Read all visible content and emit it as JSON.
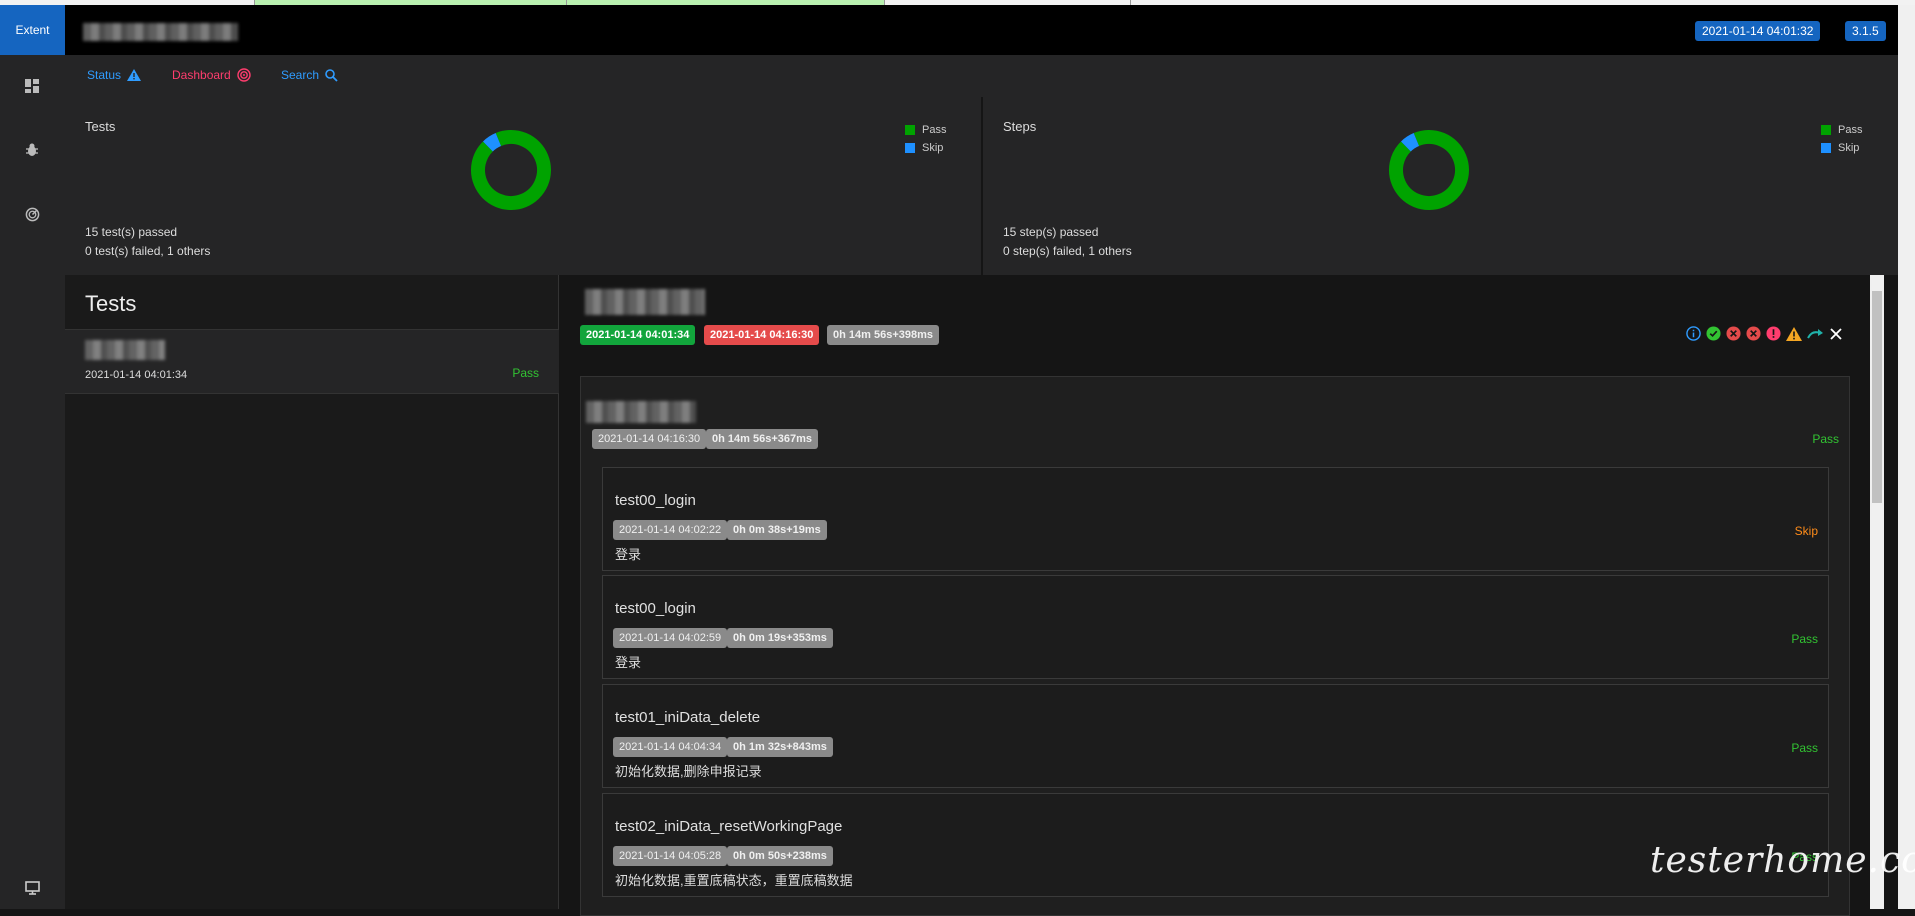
{
  "brand": "Extent",
  "header": {
    "start_time": "2021-01-14 04:01:32",
    "version": "3.1.5"
  },
  "nav": {
    "status": "Status",
    "dashboard": "Dashboard",
    "search": "Search"
  },
  "tests_panel": {
    "title": "Tests",
    "legend": [
      "Pass",
      "Skip"
    ],
    "summary_line1": "15 test(s) passed",
    "summary_line2": "0 test(s) failed, 1 others"
  },
  "steps_panel": {
    "title": "Steps",
    "legend": [
      "Pass",
      "Skip"
    ],
    "summary_line1": "15 step(s) passed",
    "summary_line2": "0 step(s) failed, 1 others"
  },
  "colors": {
    "pass": "#00a300",
    "skip": "#1e90ff",
    "brand": "#1565c0"
  },
  "chart_data": [
    {
      "type": "pie",
      "title": "Tests",
      "categories": [
        "Pass",
        "Skip"
      ],
      "values": [
        15,
        1
      ]
    },
    {
      "type": "pie",
      "title": "Steps",
      "categories": [
        "Pass",
        "Skip"
      ],
      "values": [
        15,
        1
      ]
    }
  ],
  "test_list": {
    "heading": "Tests",
    "items": [
      {
        "time": "2021-01-14 04:01:34",
        "status": "Pass"
      }
    ]
  },
  "detail": {
    "start": "2021-01-14 04:01:34",
    "end": "2021-01-14 04:16:30",
    "duration": "0h 14m 56s+398ms",
    "group": {
      "time": "2021-01-14 04:16:30",
      "duration": "0h 14m 56s+367ms",
      "status": "Pass"
    },
    "nodes": [
      {
        "name": "test00_login",
        "time": "2021-01-14 04:02:22",
        "duration": "0h 0m 38s+19ms",
        "desc": "登录",
        "status": "Skip"
      },
      {
        "name": "test00_login",
        "time": "2021-01-14 04:02:59",
        "duration": "0h 0m 19s+353ms",
        "desc": "登录",
        "status": "Pass"
      },
      {
        "name": "test01_iniData_delete",
        "time": "2021-01-14 04:04:34",
        "duration": "0h 1m 32s+843ms",
        "desc": "初始化数据,删除申报记录",
        "status": "Pass"
      },
      {
        "name": "test02_iniData_resetWorkingPage",
        "time": "2021-01-14 04:05:28",
        "duration": "0h 0m 50s+238ms",
        "desc": "初始化数据,重置底稿状态，重置底稿数据",
        "status": "Pass"
      }
    ]
  },
  "watermark": "testerhome.com",
  "icons": [
    "dashboard-icon",
    "bug-icon",
    "speedometer-icon",
    "monitor-icon",
    "warning-icon",
    "target-icon",
    "search-icon",
    "info-icon",
    "check-icon",
    "close-circle-icon",
    "error-icon",
    "warning-icon",
    "redo-icon",
    "close-icon"
  ]
}
